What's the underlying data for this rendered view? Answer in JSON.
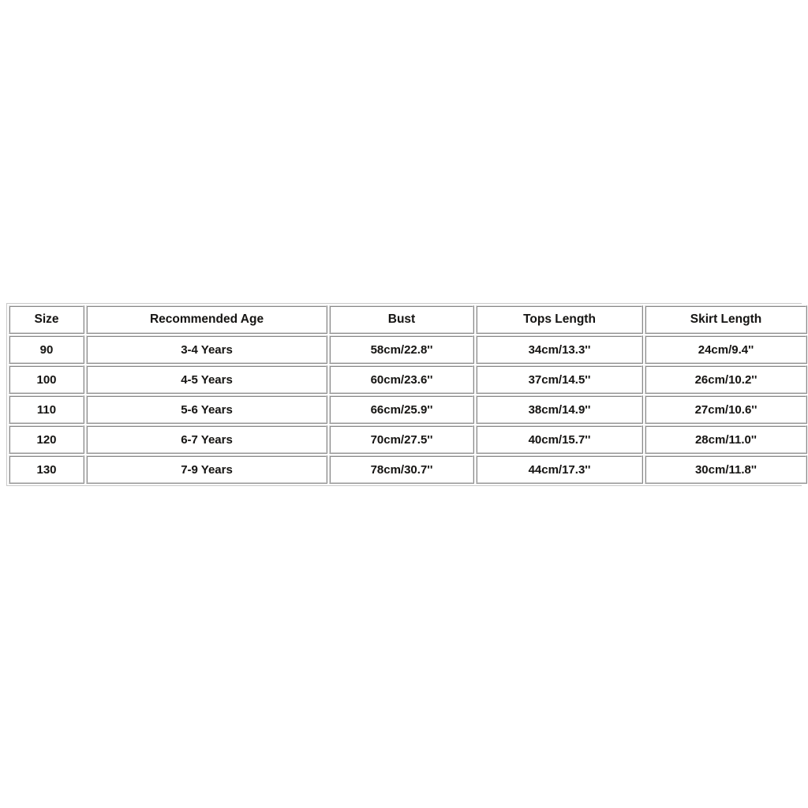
{
  "table": {
    "name": "size-chart",
    "columns": [
      {
        "key": "size",
        "label": "Size"
      },
      {
        "key": "age",
        "label": "Recommended Age"
      },
      {
        "key": "bust",
        "label": "Bust"
      },
      {
        "key": "tops",
        "label": "Tops Length"
      },
      {
        "key": "skirt",
        "label": "Skirt Length"
      }
    ],
    "rows": [
      {
        "size": "90",
        "age": "3-4 Years",
        "bust": "58cm/22.8''",
        "tops": "34cm/13.3''",
        "skirt": "24cm/9.4''"
      },
      {
        "size": "100",
        "age": "4-5 Years",
        "bust": "60cm/23.6''",
        "tops": "37cm/14.5''",
        "skirt": "26cm/10.2''"
      },
      {
        "size": "110",
        "age": "5-6 Years",
        "bust": "66cm/25.9''",
        "tops": "38cm/14.9''",
        "skirt": "27cm/10.6''"
      },
      {
        "size": "120",
        "age": "6-7 Years",
        "bust": "70cm/27.5''",
        "tops": "40cm/15.7''",
        "skirt": "28cm/11.0''"
      },
      {
        "size": "130",
        "age": "7-9 Years",
        "bust": "78cm/30.7''",
        "tops": "44cm/17.3''",
        "skirt": "30cm/11.8''"
      }
    ]
  },
  "colors": {
    "page_background": "#ffffff",
    "cell_background": "#ffffff",
    "cell_border": "#dcdcdc",
    "outer_border": "#c9c9c9",
    "text": "#151515"
  }
}
